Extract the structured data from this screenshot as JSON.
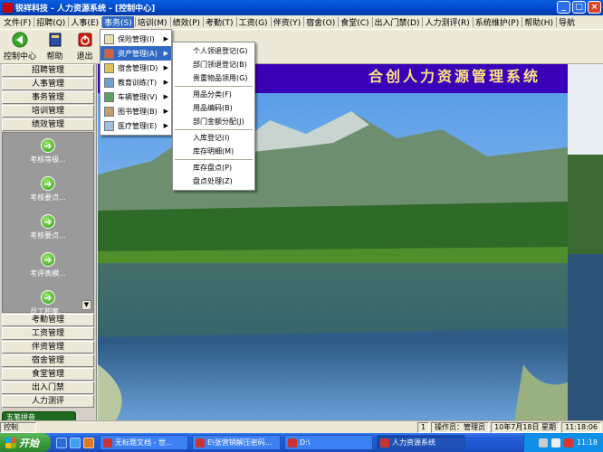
{
  "window": {
    "title": "锐祥科技 - 人力资源系统 - [控制中心]"
  },
  "menubar": [
    {
      "label": "文件(F)"
    },
    {
      "label": "招聘(Q)"
    },
    {
      "label": "人事(E)"
    },
    {
      "label": "事务(S)",
      "active": true
    },
    {
      "label": "培训(M)"
    },
    {
      "label": "绩效(P)"
    },
    {
      "label": "考勤(T)"
    },
    {
      "label": "工资(G)"
    },
    {
      "label": "伴资(Y)"
    },
    {
      "label": "宿舍(O)"
    },
    {
      "label": "食堂(C)"
    },
    {
      "label": "出入门禁(D)"
    },
    {
      "label": "人力测评(R)"
    },
    {
      "label": "系统维护(P)"
    },
    {
      "label": "帮助(H)"
    },
    {
      "label": "导航"
    }
  ],
  "toolbar": {
    "control_center": "控制中心",
    "help": "帮助",
    "exit": "退出"
  },
  "sidebar": {
    "groups_top": [
      "招聘管理",
      "人事管理",
      "事务管理",
      "培训管理",
      "绩效管理"
    ],
    "items": [
      {
        "label": "考核等级..."
      },
      {
        "label": "考核要点..."
      },
      {
        "label": "考核要点..."
      },
      {
        "label": "考评表模..."
      },
      {
        "label": "员工积案..."
      }
    ],
    "groups_bottom": [
      "考勤管理",
      "工资管理",
      "伴资管理",
      "宿舍管理",
      "食堂管理",
      "出入门禁",
      "人力测评"
    ],
    "scroll_glyph": "▼"
  },
  "ime": {
    "line1": "五笔拼音",
    "line2": "简 圆"
  },
  "banner": {
    "title": "合创人力资源管理系统"
  },
  "menu_l1": [
    {
      "label": "保险管理(I)",
      "arrow": "▶"
    },
    {
      "label": "资产管理(A)",
      "arrow": "▶",
      "highlight": true
    },
    {
      "label": "宿舍管理(D)",
      "arrow": "▶"
    },
    {
      "label": "教育训练(T)",
      "arrow": "▶"
    },
    {
      "label": "车辆管理(V)",
      "arrow": "▶"
    },
    {
      "label": "图书管理(B)",
      "arrow": "▶"
    },
    {
      "label": "医疗管理(E)",
      "arrow": "▶"
    }
  ],
  "menu_l2": [
    {
      "label": "个人领退登记(G)"
    },
    {
      "label": "部门领退登记(B)"
    },
    {
      "label": "贵重物品领用(G)"
    },
    {
      "sep": true
    },
    {
      "label": "用品分类(F)"
    },
    {
      "label": "用品编码(B)"
    },
    {
      "label": "部门金额分配(J)"
    },
    {
      "sep": true
    },
    {
      "label": "入库登记(I)"
    },
    {
      "label": "库存明细(M)"
    },
    {
      "sep": true
    },
    {
      "label": "库存盘点(P)"
    },
    {
      "label": "盘点处理(Z)"
    }
  ],
  "statusbar": {
    "left": "控制",
    "count": "1",
    "operator": "操作员：管理员",
    "date": "10年7月18日 星期",
    "time": "11:18:06"
  },
  "taskbar": {
    "start": "开始",
    "tasks": [
      {
        "label": "无标题文档 - 世..."
      },
      {
        "label": "E\\张营销解压密码..."
      },
      {
        "label": "D:\\"
      },
      {
        "label": "人力资源系统",
        "active": true
      }
    ],
    "clock": "11:18"
  },
  "colors": {
    "banner_bg": "#3a00b8",
    "banner_text": "#ffe680",
    "highlight": "#316ac5"
  }
}
